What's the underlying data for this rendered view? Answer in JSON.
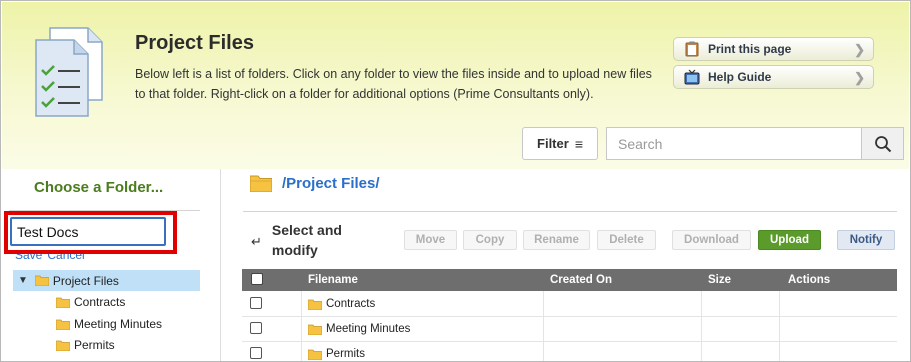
{
  "header": {
    "title": "Project Files",
    "description": "Below left is a list of folders. Click on any folder to view the files inside and to upload new files to that folder. Right-click on a folder for additional options (Prime Consultants only).",
    "print_label": "Print this page",
    "help_label": "Help Guide",
    "filter_label": "Filter",
    "search_placeholder": "Search"
  },
  "left_panel": {
    "title": "Choose a Folder...",
    "save_label": "Save",
    "cancel_label": "Cancel",
    "rename_value": "Test Docs",
    "tree": {
      "root": "Project Files",
      "children": [
        "Contracts",
        "Meeting Minutes",
        "Permits"
      ]
    }
  },
  "main": {
    "path": "/Project Files/",
    "select_modify_label": "Select and modify",
    "actions": {
      "move": "Move",
      "copy": "Copy",
      "rename": "Rename",
      "delete": "Delete",
      "download": "Download",
      "upload": "Upload",
      "notify": "Notify"
    },
    "table": {
      "headers": [
        "Filename",
        "Created On",
        "Size",
        "Actions"
      ],
      "rows": [
        {
          "filename": "Contracts"
        },
        {
          "filename": "Meeting Minutes"
        },
        {
          "filename": "Permits"
        }
      ]
    }
  },
  "colors": {
    "header_bg": "#eef3a8",
    "accent_green": "#4b7c1e",
    "link_blue": "#2a6fc9",
    "upload_green": "#5a9b2c",
    "highlight_red": "#e00000",
    "tree_selected": "#bfe0f7",
    "table_head": "#6e6e6e"
  },
  "icons": {
    "header_doc": "checklist-document-icon",
    "print": "clipboard-icon",
    "help": "tv-icon",
    "filter": "filter-lines-icon",
    "search": "magnifier-icon",
    "folder": "folder-icon"
  }
}
